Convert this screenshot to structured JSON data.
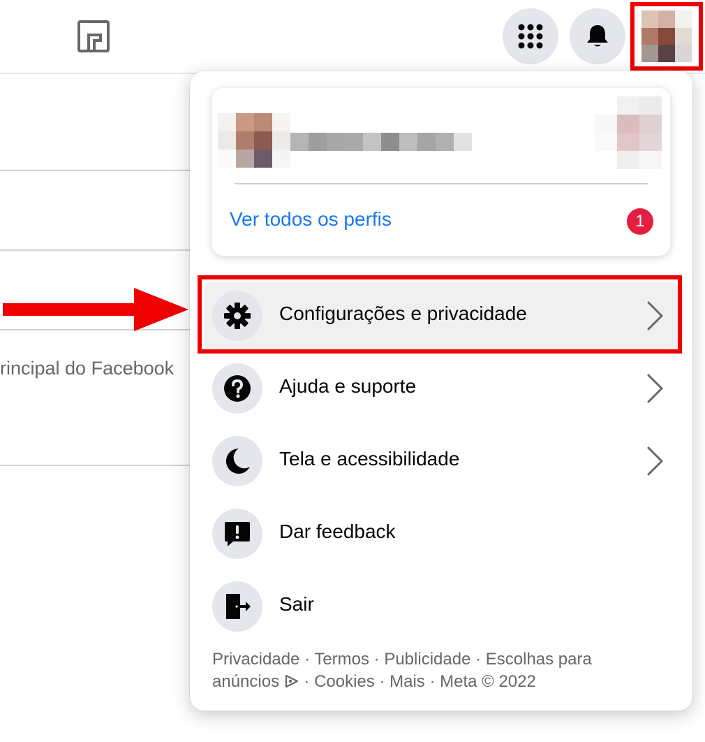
{
  "topbar": {
    "icons": {
      "logo": "facebook-outline-logo",
      "menu": "grid-menu-icon",
      "notifications": "bell-icon",
      "account": "avatar"
    }
  },
  "background": {
    "partial_text": "rincipal do Facebook"
  },
  "dropdown": {
    "profile": {
      "see_all_profiles": "Ver todos os perfis",
      "notification_count": "1"
    },
    "items": [
      {
        "label": "Configurações e privacidade",
        "icon": "gear-icon",
        "has_chevron": true,
        "highlighted": true
      },
      {
        "label": "Ajuda e suporte",
        "icon": "question-icon",
        "has_chevron": true
      },
      {
        "label": "Tela e acessibilidade",
        "icon": "moon-icon",
        "has_chevron": true
      },
      {
        "label": "Dar feedback",
        "icon": "feedback-icon",
        "has_chevron": false
      },
      {
        "label": "Sair",
        "icon": "logout-icon",
        "has_chevron": false
      }
    ],
    "footer": {
      "privacy": "Privacidade",
      "terms": "Termos",
      "advertising": "Publicidade",
      "ad_choices": "Escolhas para anúncios",
      "cookies": "Cookies",
      "more": "Mais",
      "meta": "Meta © 2022",
      "separator": " · "
    }
  },
  "colors": {
    "accent": "#1877f2",
    "badge": "#e41e3f",
    "annotation": "#ef0000",
    "icon_bg": "#e4e6eb"
  }
}
